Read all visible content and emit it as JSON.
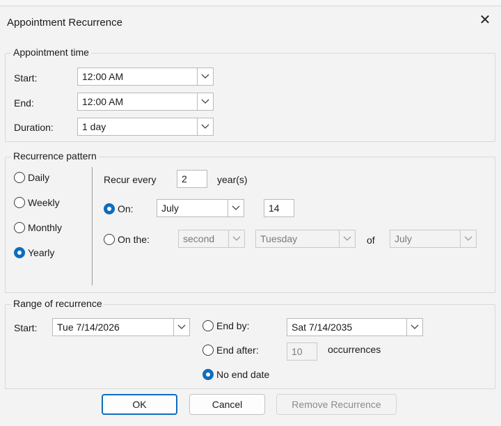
{
  "dialog": {
    "title": "Appointment Recurrence"
  },
  "appointment_time": {
    "legend": "Appointment time",
    "start_label": "Start:",
    "start_value": "12:00 AM",
    "end_label": "End:",
    "end_value": "12:00 AM",
    "duration_label": "Duration:",
    "duration_value": "1 day"
  },
  "recurrence_pattern": {
    "legend": "Recurrence pattern",
    "options": [
      "Daily",
      "Weekly",
      "Monthly",
      "Yearly"
    ],
    "selected_option": "Yearly",
    "recur_every_label": "Recur every",
    "recur_every_value": "2",
    "recur_every_unit": "year(s)",
    "on_label": "On:",
    "on_month": "July",
    "on_day": "14",
    "on_the_label": "On the:",
    "on_the_ordinal": "second",
    "on_the_weekday": "Tuesday",
    "of_label": "of",
    "on_the_month": "July",
    "selected_yearly_mode": "On"
  },
  "range": {
    "legend": "Range of recurrence",
    "start_label": "Start:",
    "start_value": "Tue 7/14/2026",
    "end_by_label": "End by:",
    "end_by_value": "Sat 7/14/2035",
    "end_after_label": "End after:",
    "end_after_value": "10",
    "occurrences_label": "occurrences",
    "no_end_label": "No end date",
    "selected": "No end date"
  },
  "buttons": {
    "ok": "OK",
    "cancel": "Cancel",
    "remove": "Remove Recurrence"
  },
  "colors": {
    "accent": "#0f6cbd",
    "background": "#f3f3f3"
  },
  "icons": {
    "close": "close-icon",
    "dropdown": "chevron-down-icon"
  }
}
